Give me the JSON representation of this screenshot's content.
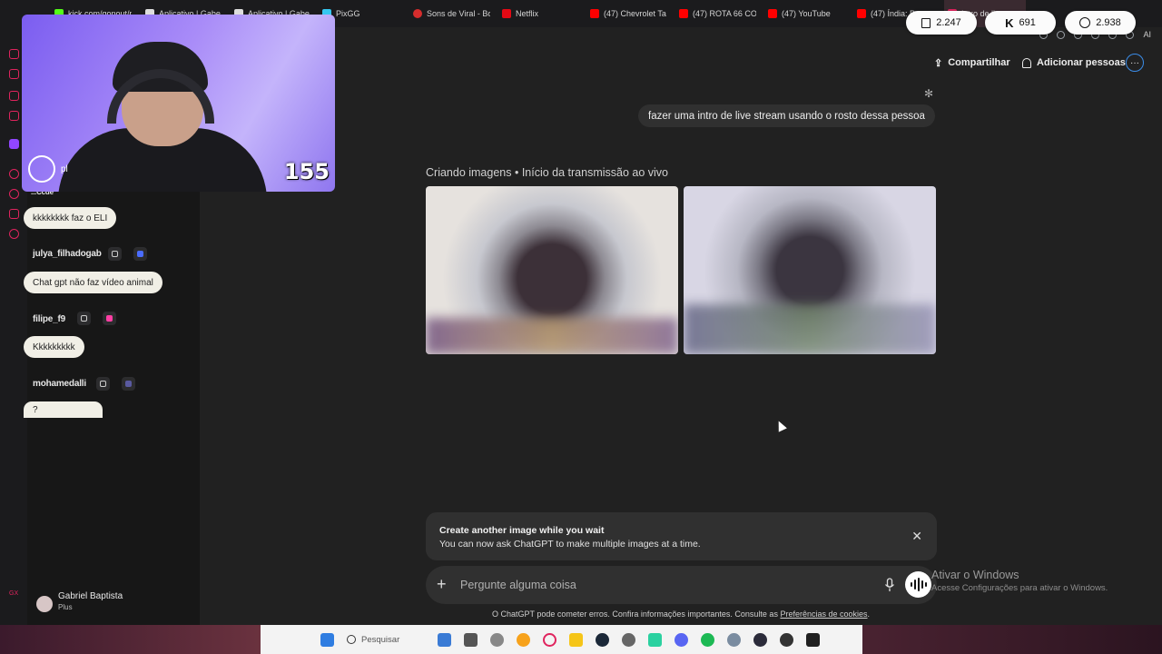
{
  "browser": {
    "tabs": [
      {
        "label": "kick.com/gonout/p",
        "color": "#53fc18"
      },
      {
        "label": "Aplicativo | Gabe",
        "color": "#dddddd"
      },
      {
        "label": "Aplicativo | Gabe",
        "color": "#dddddd"
      },
      {
        "label": "PixGG",
        "color": "#35c7f0"
      },
      {
        "label": "Sons de Viral - Bo",
        "color": "#d62d2d"
      },
      {
        "label": "Netflix",
        "color": "#e50914"
      },
      {
        "label": "(47) Chevrolet Ta",
        "color": "#ff0000"
      },
      {
        "label": "(47) ROTA 66 CO",
        "color": "#ff0000"
      },
      {
        "label": "(47) YouTube",
        "color": "#ff0000"
      },
      {
        "label": "(47) Índia: P",
        "color": "#ff0000"
      },
      {
        "label": "Intro de live strea",
        "color": "#e0245e"
      }
    ],
    "ai_label": "AI"
  },
  "viewers": {
    "twitch": "2.247",
    "kick": "691",
    "total": "2.938"
  },
  "webcam": {
    "counter": "155",
    "overlay_text": "pl"
  },
  "chat": {
    "partial_name": "...Ccde",
    "messages": [
      {
        "user": "",
        "text": "kkkkkkkk faz o ELI",
        "badge_color": "#6b6bff"
      },
      {
        "user": "julya_filhadogab",
        "text": "Chat gpt não faz vídeo animal",
        "badge_color": "#4a6cff"
      },
      {
        "user": "filipe_f9",
        "text": "Kkkkkkkkk",
        "badge_color": "#ff3fa4"
      },
      {
        "user": "mohamedalli",
        "text": "?",
        "badge_color": "#5a5aa0"
      }
    ]
  },
  "header": {
    "share_label": "Compartilhar",
    "add_people_label": "Adicionar pessoas",
    "more_label": "···"
  },
  "conversation": {
    "user_message": "fazer uma intro de live stream usando o rosto dessa pessoa",
    "image_status": "Criando imagens • Início da transmissão ao vivo"
  },
  "toast": {
    "title": "Create another image while you wait",
    "body": "You can now ask ChatGPT to make multiple images at a time.",
    "close": "✕"
  },
  "composer": {
    "placeholder": "Pergunte alguma coisa",
    "plus": "+"
  },
  "disclaimer": {
    "text": "O ChatGPT pode cometer erros. Confira informações importantes. Consulte as ",
    "link": "Preferências de cookies",
    "end": "."
  },
  "windows": {
    "activate_title": "Ativar o Windows",
    "activate_sub": "Acesse Configurações para ativar o Windows.",
    "search_label": "Pesquisar"
  },
  "profile": {
    "name": "Gabriel Baptista",
    "plan": "Plus"
  },
  "taskbar_icons": [
    "#3a7bd5",
    "#555555",
    "#888888",
    "#f7a21b",
    "#e0245e",
    "#f5c518",
    "#1b2838",
    "#666666",
    "#2bd1a0",
    "#5865f2",
    "#1db954",
    "#7a8ca0",
    "#2b2b3a",
    "#333333",
    "#202020"
  ]
}
